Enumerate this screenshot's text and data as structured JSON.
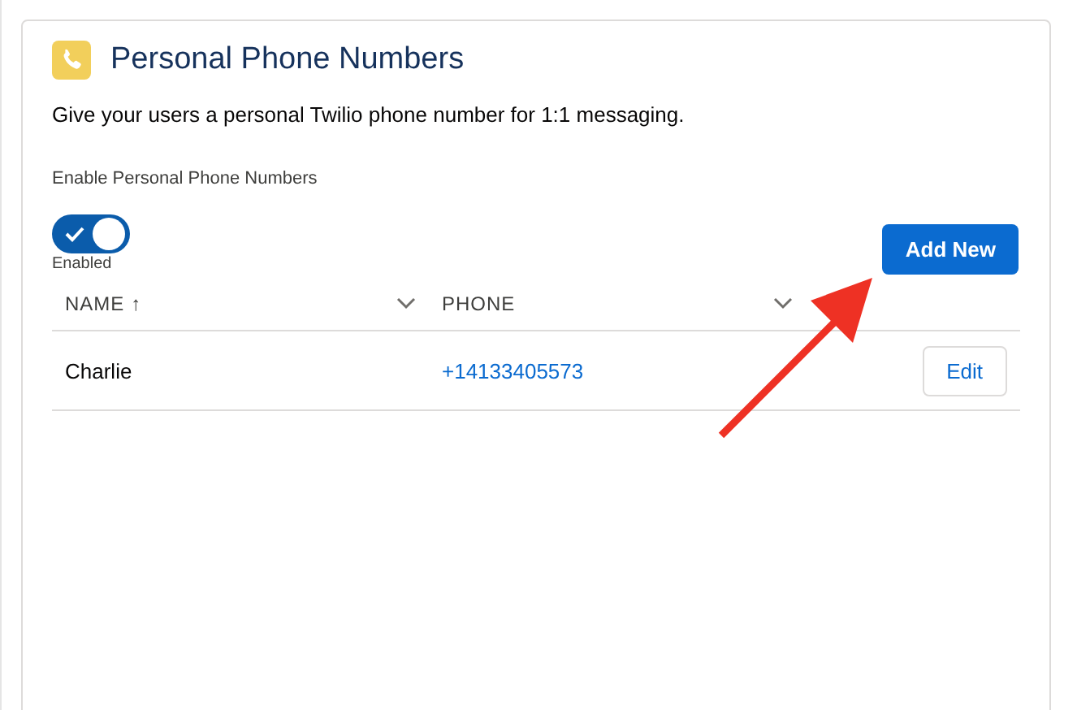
{
  "card": {
    "title": "Personal Phone Numbers",
    "description": "Give your users a personal Twilio phone number for 1:1 messaging."
  },
  "toggle": {
    "label": "Enable Personal Phone Numbers",
    "on": true,
    "status": "Enabled"
  },
  "add_button": "Add New",
  "table": {
    "columns": [
      {
        "label": "NAME",
        "sort": "↑"
      },
      {
        "label": "PHONE"
      }
    ],
    "rows": [
      {
        "name": "Charlie",
        "phone": "+14133405573",
        "action": "Edit"
      }
    ]
  }
}
